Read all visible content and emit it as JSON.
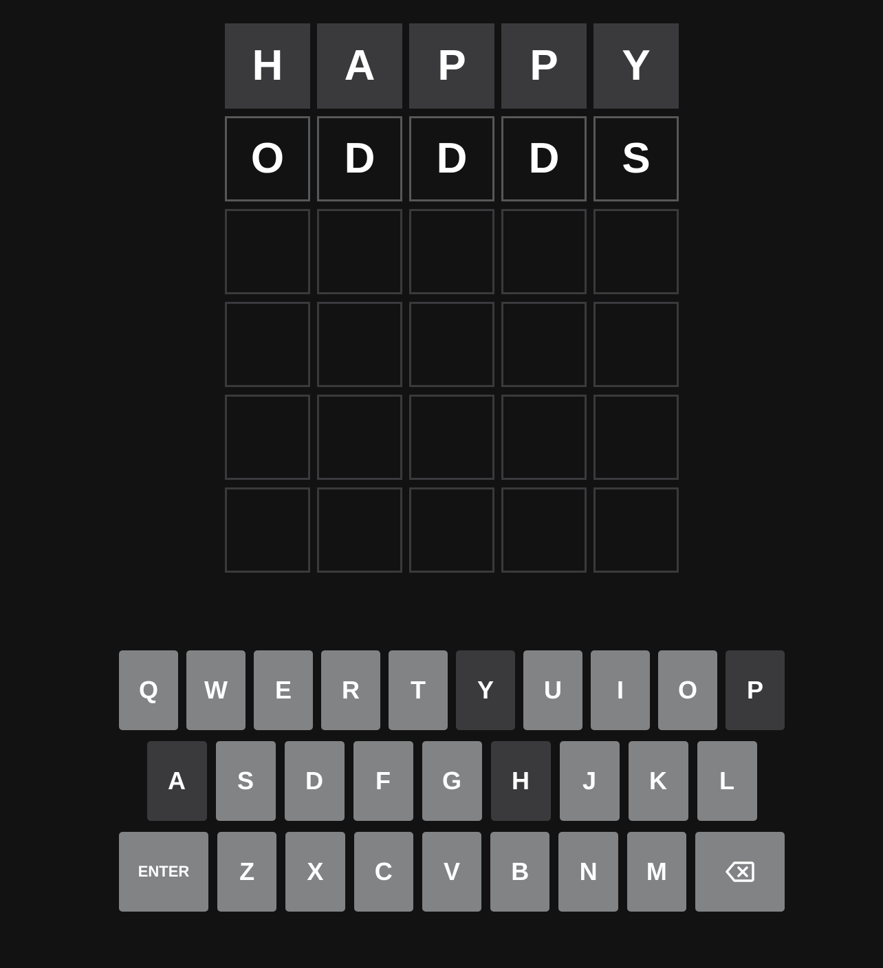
{
  "board": {
    "rows": [
      {
        "tiles": [
          {
            "letter": "H",
            "state": "absent"
          },
          {
            "letter": "A",
            "state": "absent"
          },
          {
            "letter": "P",
            "state": "absent"
          },
          {
            "letter": "P",
            "state": "absent"
          },
          {
            "letter": "Y",
            "state": "absent"
          }
        ]
      },
      {
        "tiles": [
          {
            "letter": "O",
            "state": "tbd"
          },
          {
            "letter": "D",
            "state": "tbd"
          },
          {
            "letter": "D",
            "state": "tbd"
          },
          {
            "letter": "D",
            "state": "tbd"
          },
          {
            "letter": "S",
            "state": "tbd"
          }
        ]
      },
      {
        "tiles": [
          {
            "letter": "",
            "state": "empty"
          },
          {
            "letter": "",
            "state": "empty"
          },
          {
            "letter": "",
            "state": "empty"
          },
          {
            "letter": "",
            "state": "empty"
          },
          {
            "letter": "",
            "state": "empty"
          }
        ]
      },
      {
        "tiles": [
          {
            "letter": "",
            "state": "empty"
          },
          {
            "letter": "",
            "state": "empty"
          },
          {
            "letter": "",
            "state": "empty"
          },
          {
            "letter": "",
            "state": "empty"
          },
          {
            "letter": "",
            "state": "empty"
          }
        ]
      },
      {
        "tiles": [
          {
            "letter": "",
            "state": "empty"
          },
          {
            "letter": "",
            "state": "empty"
          },
          {
            "letter": "",
            "state": "empty"
          },
          {
            "letter": "",
            "state": "empty"
          },
          {
            "letter": "",
            "state": "empty"
          }
        ]
      },
      {
        "tiles": [
          {
            "letter": "",
            "state": "empty"
          },
          {
            "letter": "",
            "state": "empty"
          },
          {
            "letter": "",
            "state": "empty"
          },
          {
            "letter": "",
            "state": "empty"
          },
          {
            "letter": "",
            "state": "empty"
          }
        ]
      }
    ]
  },
  "keyboard": {
    "rows": [
      [
        {
          "label": "Q",
          "state": "unused"
        },
        {
          "label": "W",
          "state": "unused"
        },
        {
          "label": "E",
          "state": "unused"
        },
        {
          "label": "R",
          "state": "unused"
        },
        {
          "label": "T",
          "state": "unused"
        },
        {
          "label": "Y",
          "state": "absent"
        },
        {
          "label": "U",
          "state": "unused"
        },
        {
          "label": "I",
          "state": "unused"
        },
        {
          "label": "O",
          "state": "unused"
        },
        {
          "label": "P",
          "state": "absent"
        }
      ],
      [
        {
          "label": "A",
          "state": "absent"
        },
        {
          "label": "S",
          "state": "unused"
        },
        {
          "label": "D",
          "state": "unused"
        },
        {
          "label": "F",
          "state": "unused"
        },
        {
          "label": "G",
          "state": "unused"
        },
        {
          "label": "H",
          "state": "absent"
        },
        {
          "label": "J",
          "state": "unused"
        },
        {
          "label": "K",
          "state": "unused"
        },
        {
          "label": "L",
          "state": "unused"
        }
      ],
      [
        {
          "label": "ENTER",
          "state": "unused",
          "wide": true
        },
        {
          "label": "Z",
          "state": "unused"
        },
        {
          "label": "X",
          "state": "unused"
        },
        {
          "label": "C",
          "state": "unused"
        },
        {
          "label": "V",
          "state": "unused"
        },
        {
          "label": "B",
          "state": "unused"
        },
        {
          "label": "N",
          "state": "unused"
        },
        {
          "label": "M",
          "state": "unused"
        },
        {
          "label": "",
          "icon": "backspace-icon",
          "state": "unused",
          "wide": true
        }
      ]
    ]
  },
  "colors": {
    "background": "#121213",
    "absent": "#3a3a3c",
    "unused_key": "#818384",
    "tbd_border": "#565758",
    "empty_border": "#3a3a3c",
    "text": "#ffffff"
  }
}
